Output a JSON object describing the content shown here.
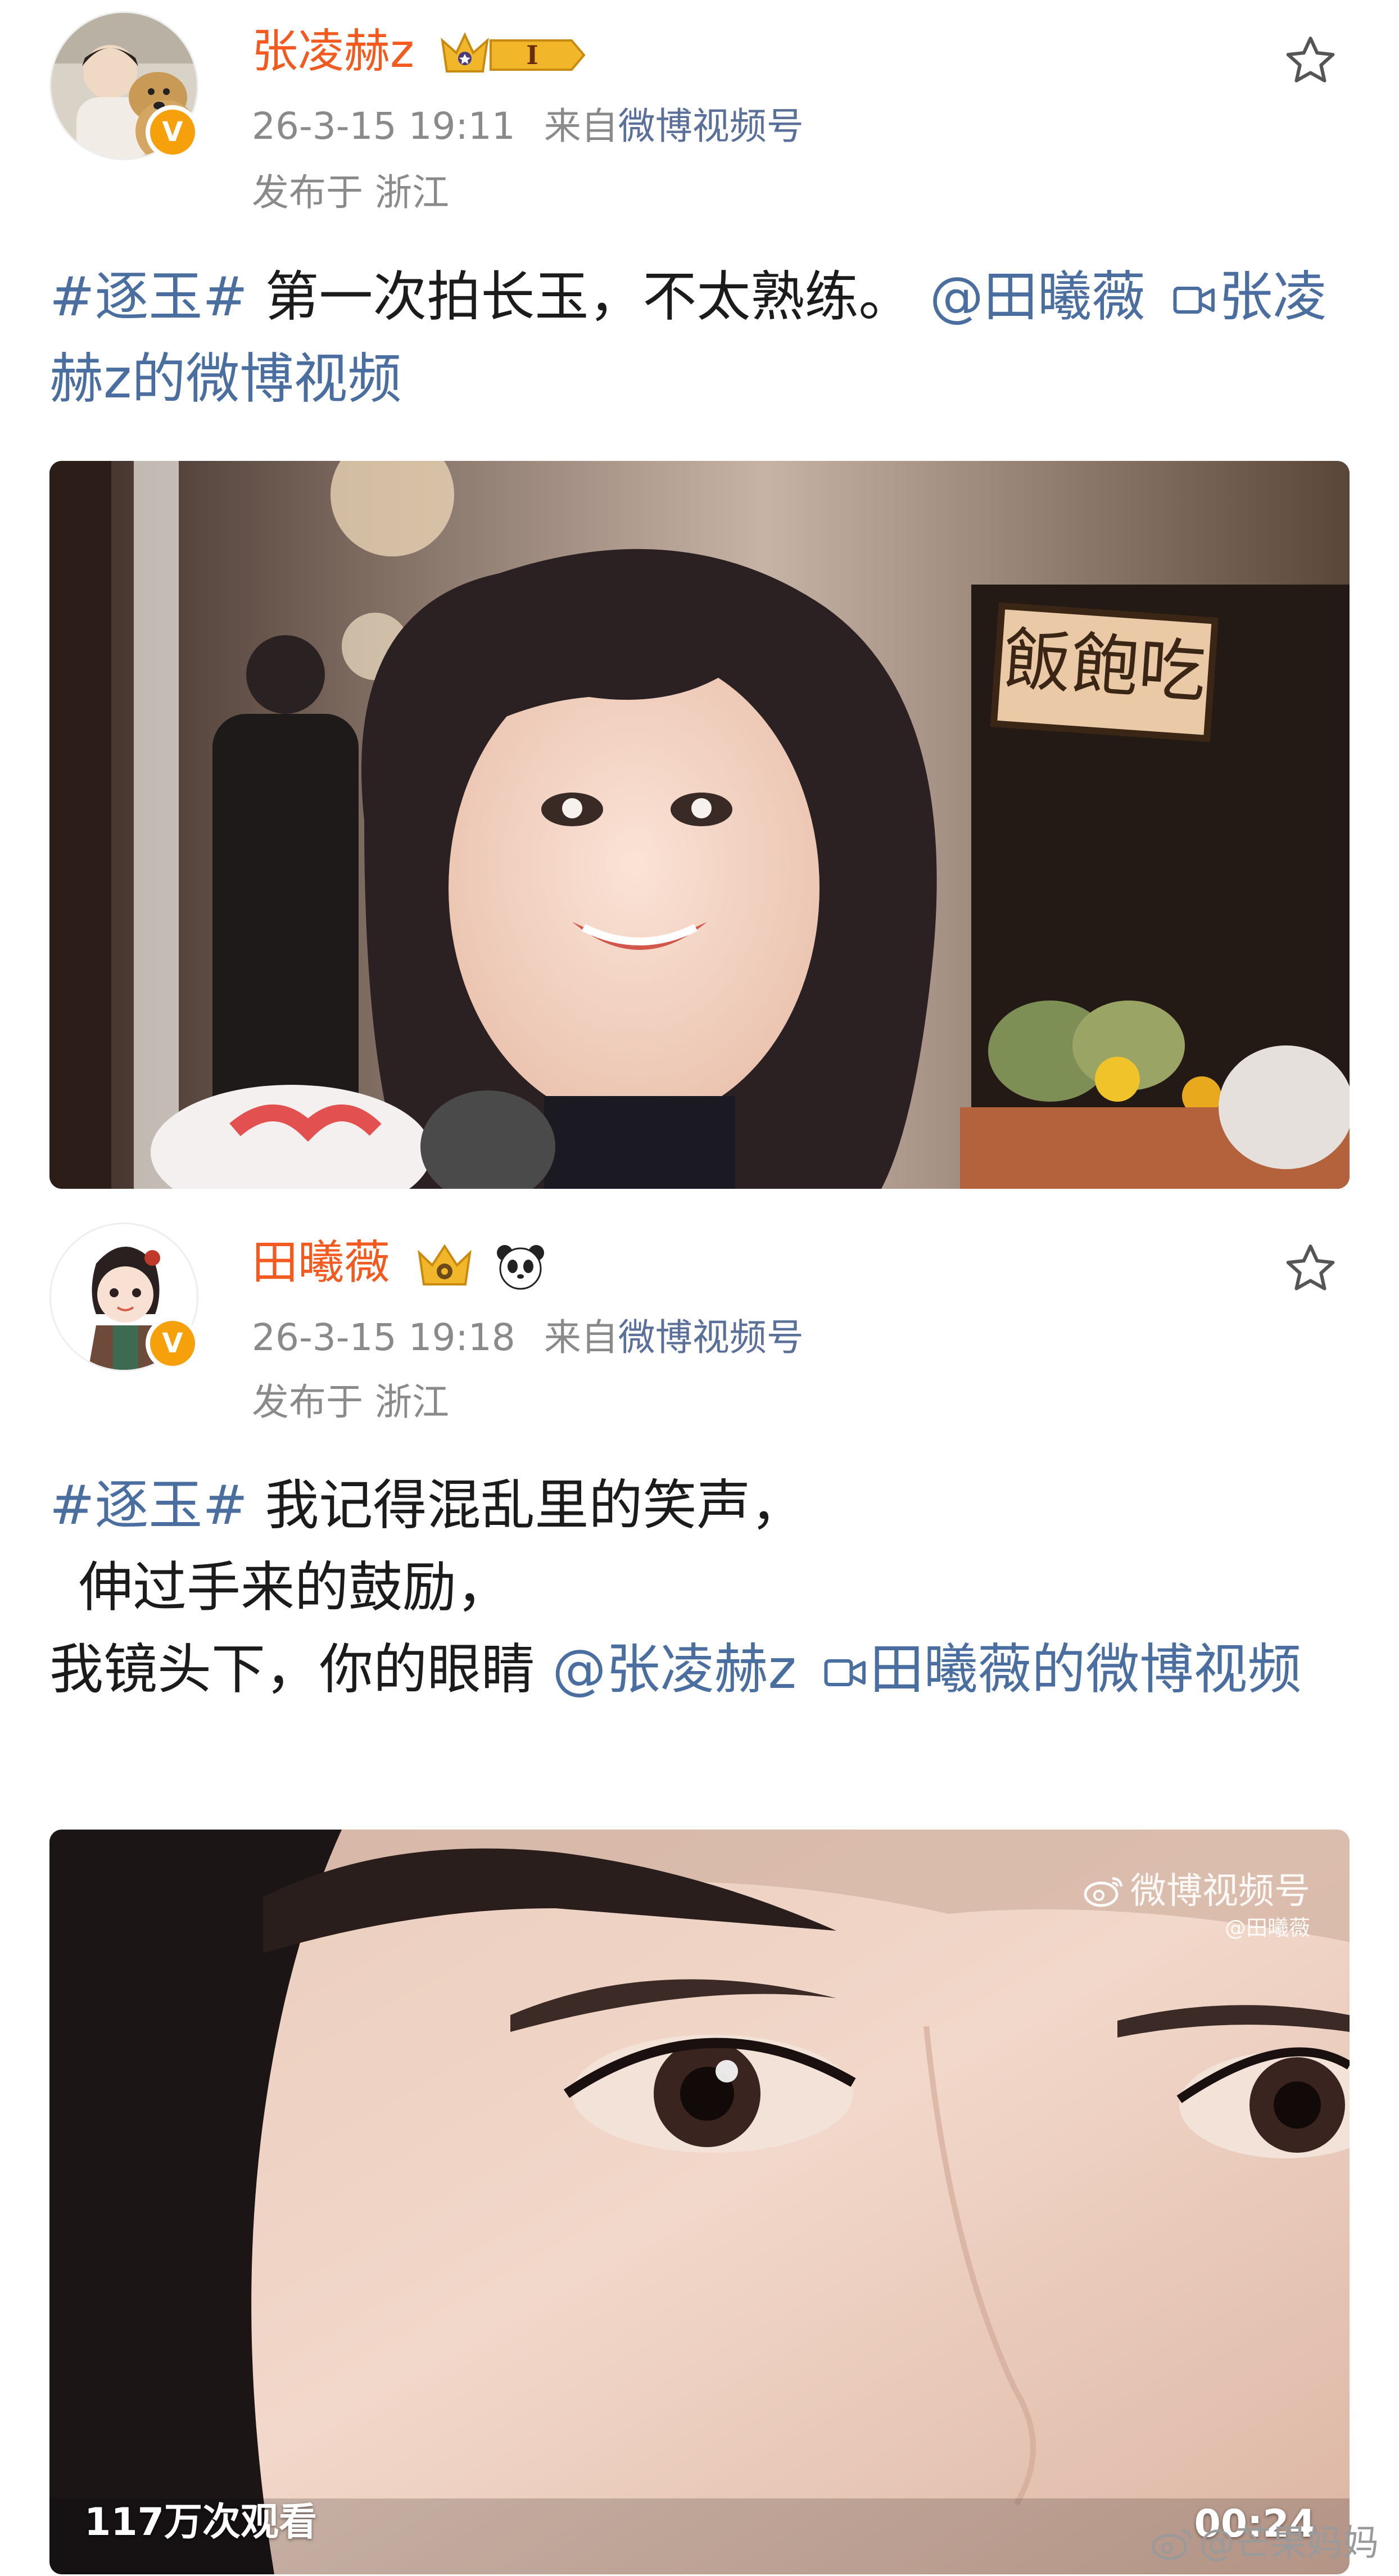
{
  "posts": [
    {
      "username": "张凌赫z",
      "time": "26-3-15 19:11",
      "source_prefix": "来自",
      "source": "微博视频号",
      "location": "发布于 浙江",
      "badge_text": "I",
      "text": {
        "hashtag": "#逐玉#",
        "body": " 第一次拍长玉，不太熟练。",
        "mention": "@田曦薇",
        "video_link": "张凌赫z的微博视频"
      },
      "media": {
        "sign_text": "飯飽吃"
      }
    },
    {
      "username": "田曦薇",
      "time": "26-3-15 19:18",
      "source_prefix": "来自",
      "source": "微博视频号",
      "location": "发布于 浙江",
      "text": {
        "hashtag": "#逐玉#",
        "line1": " 我记得混乱里的笑声，",
        "line2": "伸过手来的鼓励，",
        "line3": "我镜头下，你的眼睛 ",
        "mention": "@张凌赫z",
        "video_link": "田曦薇的微博视频"
      },
      "media": {
        "watermark": "微博视频号",
        "watermark_user": "@田曦薇",
        "views": "117万次观看",
        "duration": "00:24"
      }
    }
  ],
  "corner_watermark": "@芒果妈妈",
  "icons": {
    "star": "star-icon",
    "verified": "verified-badge-icon",
    "video": "video-icon",
    "crown": "crown-icon",
    "panda": "panda-icon",
    "weibo": "weibo-logo-icon"
  },
  "colors": {
    "username": "#f35a1f",
    "link": "#4a6ea0",
    "meta": "#8a8a8a"
  }
}
